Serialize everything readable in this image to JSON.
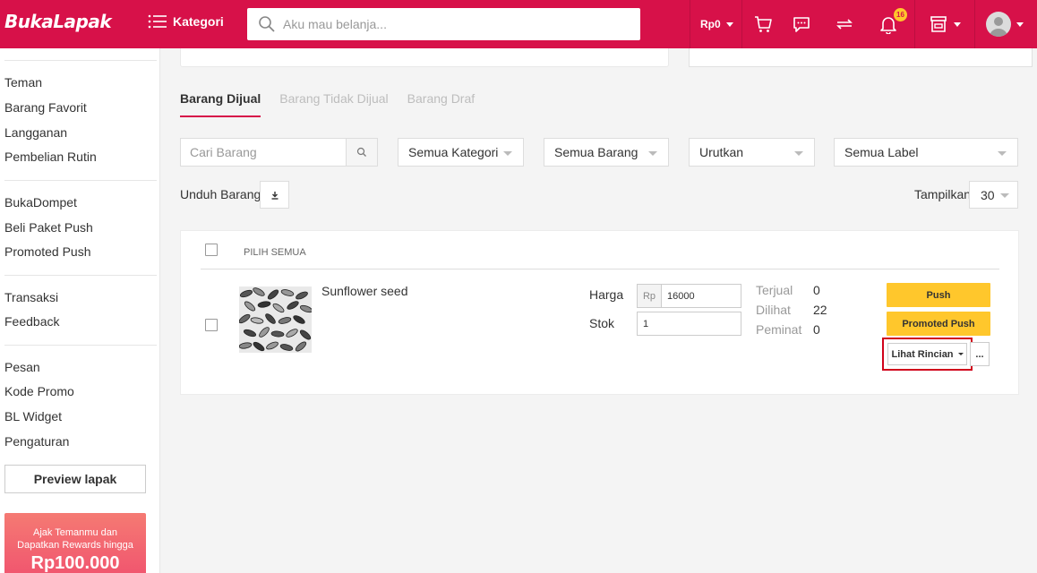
{
  "header": {
    "logo": "BukaLapak",
    "kategori_label": "Kategori",
    "search_placeholder": "Aku mau belanja...",
    "saldo": "Rp0",
    "notification_count": "16",
    "icons": [
      "menu-icon",
      "search-icon",
      "cart-icon",
      "chat-icon",
      "transfer-icon",
      "bell-icon",
      "store-icon",
      "avatar"
    ],
    "brand_color": "#d71149",
    "badge_color": "#ffc72c"
  },
  "sidebar": {
    "groups": [
      [
        "Teman",
        "Barang Favorit",
        "Langganan",
        "Pembelian Rutin"
      ],
      [
        "BukaDompet",
        "Beli Paket Push",
        "Promoted Push"
      ],
      [
        "Transaksi",
        "Feedback"
      ],
      [
        "Pesan",
        "Kode Promo",
        "BL Widget",
        "Pengaturan"
      ]
    ],
    "preview_button": "Preview lapak",
    "promo": {
      "line1": "Ajak Temanmu dan",
      "line2": "Dapatkan Rewards hingga",
      "amount": "Rp100.000"
    }
  },
  "tabs": [
    {
      "label": "Barang Dijual",
      "active": true
    },
    {
      "label": "Barang Tidak Dijual",
      "active": false
    },
    {
      "label": "Barang Draf",
      "active": false
    }
  ],
  "filters": {
    "search_placeholder": "Cari Barang",
    "kategori": "Semua Kategori",
    "barang": "Semua Barang",
    "urutkan": "Urutkan",
    "label": "Semua Label"
  },
  "toolbar": {
    "unduh_label": "Unduh Barang",
    "tampilkan_label": "Tampilkan",
    "tampilkan_value": "30"
  },
  "list": {
    "pilih_semua": "PILIH SEMUA",
    "product": {
      "name": "Sunflower seed",
      "harga_label": "Harga",
      "currency": "Rp",
      "harga_value": "16000",
      "stok_label": "Stok",
      "stok_value": "1",
      "stats": [
        {
          "label": "Terjual",
          "value": "0"
        },
        {
          "label": "Dilihat",
          "value": "22"
        },
        {
          "label": "Peminat",
          "value": "0"
        }
      ],
      "push_button": "Push",
      "promoted_push_button": "Promoted Push",
      "rincian_button": "Lihat Rincian",
      "more_button": "..."
    }
  }
}
